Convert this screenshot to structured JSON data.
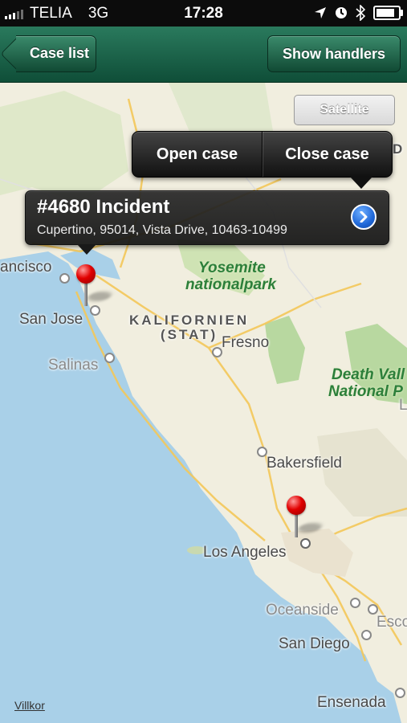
{
  "status_bar": {
    "carrier": "TELIA",
    "network": "3G",
    "time": "17:28",
    "battery_level": 0.85,
    "icons": [
      "signal-icon",
      "location-arrow-icon",
      "clock-icon",
      "bluetooth-icon",
      "battery-icon"
    ]
  },
  "nav": {
    "back_label": "Case list",
    "right_label": "Show handlers"
  },
  "map": {
    "satellite_label": "Satellite",
    "places": {
      "san_francisco": "ancisco",
      "san_jose": "San Jose",
      "salinas": "Salinas",
      "kalifornien": "KALIFORNIEN",
      "stat": "(STAT)",
      "fresno": "Fresno",
      "yosemite_1": "Yosemite",
      "yosemite_2": "nationalpark",
      "death_valley_1": "Death Vall",
      "death_valley_2": "National P",
      "bakersfield": "Bakersfield",
      "los_angeles": "Los Angeles",
      "oceanside": "Oceanside",
      "escondido": "Esco",
      "san_diego": "San Diego",
      "ensenada": "Ensenada",
      "edge_d": "D",
      "edge_l": "L"
    },
    "footer_link": "Villkor"
  },
  "callout": {
    "title": "#4680 Incident",
    "subtitle": "Cupertino, 95014, Vista Drive, 10463-10499"
  },
  "popover": {
    "open_label": "Open case",
    "close_label": "Close case"
  },
  "colors": {
    "nav_green": "#1f6a4e",
    "pin_red": "#e10000",
    "disclosure_blue": "#1f67d8",
    "ocean": "#a9d0e8",
    "land": "#f1eedf"
  }
}
